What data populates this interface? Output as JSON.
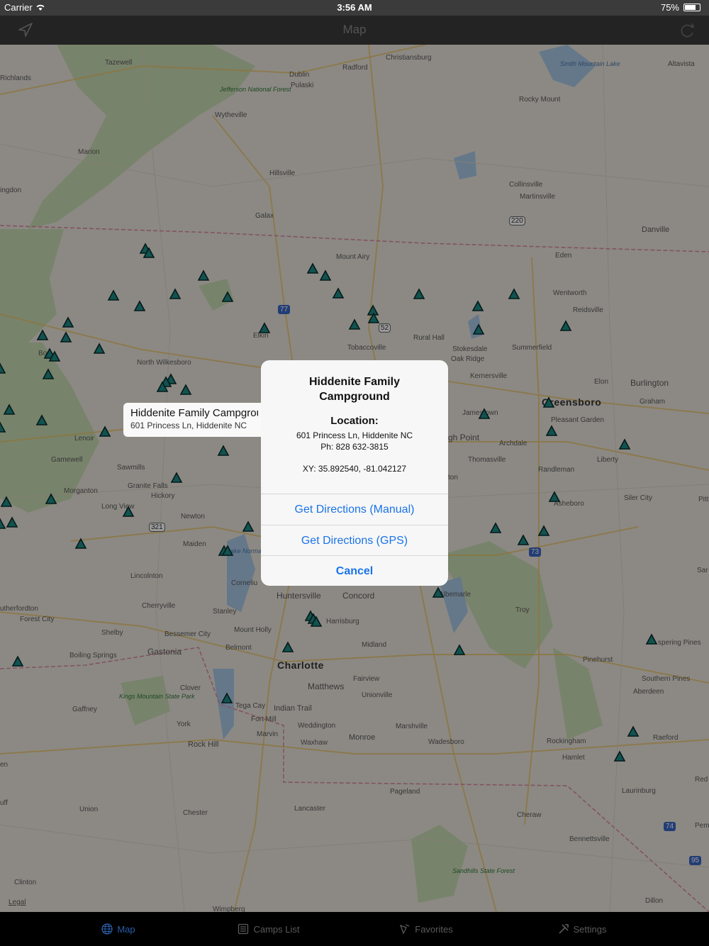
{
  "status_bar": {
    "carrier": "Carrier",
    "time": "3:56 AM",
    "battery": "75%"
  },
  "nav": {
    "title": "Map"
  },
  "map": {
    "labels": {
      "tazewell": "Tazewell",
      "richlands": "Richlands",
      "christiansburg": "Christiansburg",
      "dublin": "Dublin",
      "radford": "Radford",
      "pulaski": "Pulaski",
      "jefferson_nf": "Jefferson National Forest",
      "smith_mountain_lake": "Smith Mountain Lake",
      "altavista": "Altavista",
      "rocky_mount": "Rocky Mount",
      "wytheville": "Wytheville",
      "marion": "Marion",
      "hillsville": "Hillsville",
      "collinsville": "Collinsville",
      "martinsville": "Martinsville",
      "abingdon": "ingdon",
      "galax": "Galax",
      "us220": "220",
      "danville": "Danville",
      "mount_airy": "Mount Airy",
      "eden": "Eden",
      "wentworth": "Wentworth",
      "reidsville": "Reidsville",
      "i77": "77",
      "us52": "52",
      "elkin": "Elkin",
      "rural_hall": "Rural Hall",
      "tobaccoville": "Tobaccoville",
      "stokesdale": "Stokesdale",
      "oak_ridge": "Oak Ridge",
      "summerfield": "Summerfield",
      "boone": "Bo",
      "north_wilkesboro": "North Wilkesboro",
      "kernersville": "Kernersville",
      "elon": "Elon",
      "burlington": "Burlington",
      "graham": "Graham",
      "greensboro": "Greensboro",
      "jamestown": "Jamestown",
      "pleasant_garden": "Pleasant Garden",
      "high_point": "gh Point",
      "archdale": "Archdale",
      "lenoir": "Lenoir",
      "thomasville": "Thomasville",
      "liberty": "Liberty",
      "randleman": "Randleman",
      "gamewell": "Gamewell",
      "sawmills": "Sawmills",
      "granite_falls": "Granite Falls",
      "lexington": "ton",
      "morganton": "Morganton",
      "hickory": "Hickory",
      "long_view": "Long View",
      "asheboro": "Asheboro",
      "siler_city": "Siler City",
      "pitt": "Pitt",
      "us321": "321",
      "newton": "Newton",
      "maiden": "Maiden",
      "lake_norman": "Lake Norman",
      "us73": "73",
      "lincolnton": "Lincolnton",
      "cornelius": "Corneliu",
      "sanford": "Sar",
      "huntersville": "Huntersville",
      "concord": "Concord",
      "albemarle": "Albemarle",
      "rutherfordton": "utherfordton",
      "forest_city": "Forest City",
      "cherryville": "Cherryville",
      "stanley": "Stanley",
      "troy": "Troy",
      "harrisburg": "Harrisburg",
      "mount_holly": "Mount Holly",
      "shelby": "Shelby",
      "bessemer_city": "Bessemer City",
      "boiling_springs": "Boiling Springs",
      "gastonia": "Gastonia",
      "belmont": "Belmont",
      "midland": "Midland",
      "charlotte": "Charlotte",
      "pinehurst": "Pinehurst",
      "southern_pines": "Southern Pines",
      "aberdeen": "Aberdeen",
      "whispering_pines": "spering Pines",
      "fairview": "Fairview",
      "matthews": "Matthews",
      "unionville": "Unionville",
      "clover": "Clover",
      "kings_mountain_sp": "Kings Mountain State Park",
      "gaffney": "Gaffney",
      "tega_cay": "Tega Cay",
      "indian_trail": "Indian Trail",
      "fort_mill": "Fort Mill",
      "weddington": "Weddington",
      "marshville": "Marshville",
      "york": "York",
      "marvin": "Marvin",
      "monroe": "Monroe",
      "waxhaw": "Waxhaw",
      "wadesboro": "Wadesboro",
      "rockingham": "Rockingham",
      "raeford": "Raeford",
      "rock_hill": "Rock Hill",
      "hamlet": "Hamlet",
      "red_springs": "Red",
      "laurinburg": "Laurinburg",
      "pageland": "Pageland",
      "union": "Union",
      "lancaster": "Lancaster",
      "chester": "Chester",
      "cheraw": "Cheraw",
      "i74": "74",
      "pem": "Pem",
      "bennettsville": "Bennettsville",
      "i95": "95",
      "sandhills_sf": "Sandhills State Forest",
      "clinton": "Clinton",
      "dillon": "Dillon",
      "legal": "Legal",
      "wimpberg": "Wimpberg",
      "uff": "uff",
      "ar": "ar",
      "en": "en"
    }
  },
  "callout": {
    "title": "Hiddenite Family Campground",
    "address": "601 Princess Ln, Hiddenite NC"
  },
  "alert": {
    "title": "Hiddenite Family Campground",
    "subhead": "Location:",
    "address": "601 Princess Ln, Hiddenite NC",
    "phone": "Ph: 828 632-3815",
    "coords": "XY: 35.892540, -81.042127",
    "buttons": {
      "manual": "Get Directions (Manual)",
      "gps": "Get Directions (GPS)",
      "cancel": "Cancel"
    }
  },
  "tabs": [
    {
      "label": "Map",
      "icon": "globe-icon",
      "active": true
    },
    {
      "label": "Camps List",
      "icon": "list-icon",
      "active": false
    },
    {
      "label": "Favorites",
      "icon": "favorite-icon",
      "active": false
    },
    {
      "label": "Settings",
      "icon": "tools-icon",
      "active": false
    }
  ],
  "colors": {
    "accent": "#1a73e8",
    "tab_active": "#2a5ea8",
    "marker": "#1c8a86",
    "bar": "#3b3b3b"
  }
}
